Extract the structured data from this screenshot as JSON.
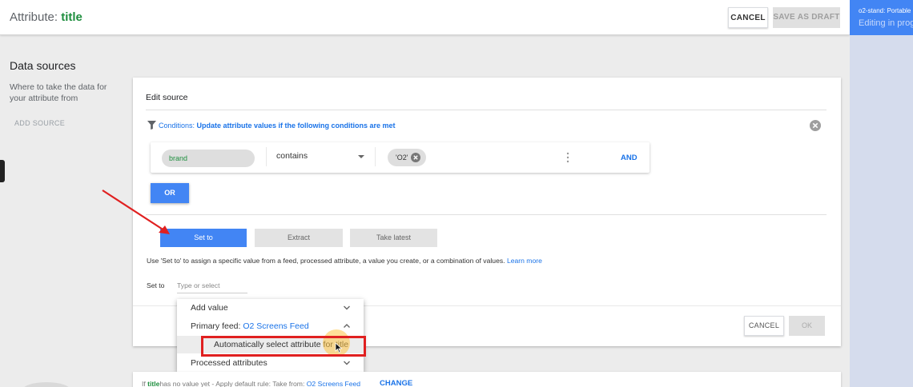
{
  "header": {
    "title_prefix": "Attribute: ",
    "title_value": "title",
    "cancel_label": "CANCEL",
    "draft_label": "SAVE AS DRAFT"
  },
  "right_panel": {
    "line1": "o2-stand: Portable",
    "line2": "Editing in prog"
  },
  "data_sources": {
    "title": "Data sources",
    "description": "Where to take the data for your attribute from",
    "add_source": "ADD SOURCE"
  },
  "edit_source": {
    "title": "Edit source",
    "conditions_prefix": "Conditions: ",
    "conditions_text": "Update attribute values if the following conditions are met",
    "rule": {
      "attribute": "brand",
      "operator": "contains",
      "value_chip": "'O2'",
      "and_label": "AND"
    },
    "or_label": "OR",
    "tabs": [
      "Set to",
      "Extract",
      "Take latest"
    ],
    "help_text": "Use 'Set to' to assign a specific value from a feed, processed attribute, a value you create, or a combination of values.",
    "learn_more": "Learn more",
    "set_to_label": "Set to",
    "set_to_placeholder": "Type or select",
    "cancel_label": "CANCEL",
    "ok_label": "OK"
  },
  "dropdown": {
    "add_value": "Add value",
    "primary_feed_label": "Primary feed: ",
    "primary_feed_name": "O2 Screens Feed",
    "auto_select": "Automatically select attribute for title",
    "processed_attributes": "Processed attributes"
  },
  "footer": {
    "prefix": "If ",
    "attr": "title",
    "middle": "has no value yet - Apply default rule: Take from: ",
    "feed": "O2 Screens Feed",
    "change": "CHANGE"
  },
  "colors": {
    "accent_blue": "#4285f4",
    "link_blue": "#1a73e8",
    "green": "#1e8e3e",
    "annotation_red": "#e02020"
  }
}
